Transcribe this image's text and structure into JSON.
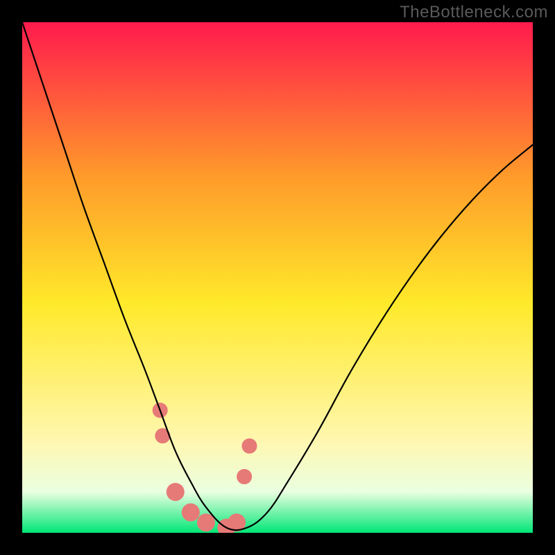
{
  "watermark": "TheBottleneck.com",
  "chart_data": {
    "type": "line",
    "title": "",
    "xlabel": "",
    "ylabel": "",
    "xlim": [
      0,
      100
    ],
    "ylim": [
      0,
      100
    ],
    "background_gradient": {
      "top": "#ff1a4d",
      "upper_mid": "#ff9a2a",
      "mid": "#ffe92a",
      "lower_mid": "#fff7b0",
      "bottom": "#00e676"
    },
    "series": [
      {
        "name": "bottleneck-curve",
        "x": [
          0,
          4,
          8,
          12,
          16,
          20,
          24,
          27,
          30,
          33,
          36,
          40,
          44,
          48,
          52,
          58,
          64,
          70,
          76,
          82,
          88,
          94,
          100
        ],
        "y": [
          100,
          88,
          76,
          64,
          53,
          42,
          32,
          24,
          16,
          10,
          5,
          1,
          1,
          4,
          10,
          20,
          31,
          41,
          50,
          58,
          65,
          71,
          76
        ]
      }
    ],
    "markers": {
      "name": "highlight-points",
      "color": "#e67a77",
      "x": [
        27,
        27.5,
        30,
        33,
        36,
        40,
        42,
        43.5,
        44.5
      ],
      "y": [
        24,
        19,
        8,
        4,
        2,
        1,
        2,
        11,
        17
      ],
      "r": [
        11,
        11,
        13,
        13,
        13,
        13,
        13,
        11,
        11
      ]
    }
  }
}
